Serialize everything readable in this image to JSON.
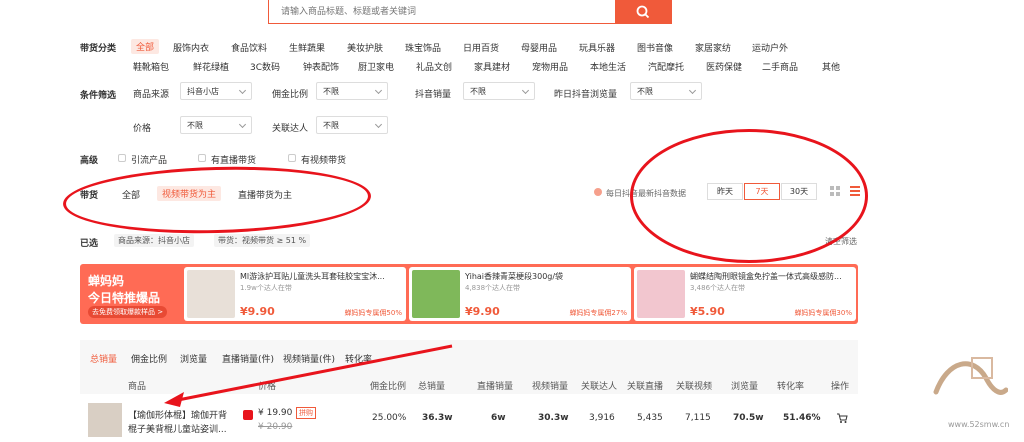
{
  "search": {
    "placeholder": "请输入商品标题、标题或者关键词"
  },
  "category": {
    "label": "带货分类",
    "row1": [
      "全部",
      "服饰内衣",
      "食品饮料",
      "生鲜蔬果",
      "美妆护肤",
      "珠宝饰品",
      "日用百货",
      "母婴用品",
      "玩具乐器",
      "图书音像",
      "家居家纺",
      "运动户外"
    ],
    "row2": [
      "鞋靴箱包",
      "鲜花绿植",
      "3C数码",
      "钟表配饰",
      "厨卫家电",
      "礼品文创",
      "家具建材",
      "宠物用品",
      "本地生活",
      "汽配摩托",
      "医药保健",
      "二手商品",
      "其他"
    ]
  },
  "filters": {
    "label": "条件筛选",
    "source_label": "商品来源",
    "source_value": "抖音小店",
    "commission_label": "佣金比例",
    "commission_value": "不限",
    "sales_label": "抖音销量",
    "sales_value": "不限",
    "views_label": "昨日抖音浏览量",
    "views_value": "不限",
    "price_label": "价格",
    "price_value": "不限",
    "talent_label": "关联达人",
    "talent_value": "不限"
  },
  "advanced": {
    "label": "高级",
    "opts": [
      "引流产品",
      "有直播带货",
      "有视频带货"
    ]
  },
  "delivery": {
    "label": "带货",
    "opts": [
      "全部",
      "视频带货为主",
      "直播带货为主"
    ],
    "active_index": 1
  },
  "update_note": "每日抖音最新抖音数据",
  "days": [
    "昨天",
    "7天",
    "30天"
  ],
  "days_active": 1,
  "selected": {
    "label": "已选",
    "tags": [
      "商品来源：抖音小店",
      "带货：视频带货 ≥ 51 %"
    ],
    "clear": "清空筛选"
  },
  "promo": {
    "title1": "蝉妈妈",
    "title2": "今日特推爆品",
    "link": "去免费领取爆款样品 >",
    "items": [
      {
        "title": "Ml游泳护耳贴儿童洗头耳套硅胶宝宝沐...",
        "sub": "1.9w个达人在带",
        "price": "¥9.90",
        "note": "蝉妈妈专属佣50%"
      },
      {
        "title": "Yihai香辣青菜梗段300g/袋",
        "sub": "4,838个达人在带",
        "price": "¥9.90",
        "note": "蝉妈妈专属佣27%"
      },
      {
        "title": "蝴蝶结陶刑眼镜盒免拧盖一体式高级感防...",
        "sub": "3,486个达人在带",
        "price": "¥5.90",
        "note": "蝉妈妈专属佣30%"
      }
    ]
  },
  "sort": [
    "总销量",
    "佣金比例",
    "浏览量",
    "直播销量(件)",
    "视频销量(件)",
    "转化率"
  ],
  "table": {
    "headers": [
      "商品",
      "价格",
      "佣金比例",
      "总销量",
      "直播销量",
      "视频销量",
      "关联达人",
      "关联直播",
      "关联视频",
      "浏览量",
      "转化率",
      "操作"
    ],
    "row": {
      "title1": "【瑜伽形体棍】瑜伽开背",
      "title2": "棍子美背棍儿童站姿训...",
      "price": "¥ 19.90",
      "badge": "拼购",
      "orig_price": "¥ 20.90",
      "commission": "25.00%",
      "total": "36.3w",
      "live": "6w",
      "video": "30.3w",
      "talent": "3,916",
      "live_rel": "5,435",
      "video_rel": "7,115",
      "views": "70.5w",
      "conv": "51.46%"
    }
  },
  "watermark": "www.52smw.cn",
  "colors": {
    "accent": "#f05a3a",
    "annotation": "#e8141c",
    "promo_bg": "#ff6b55"
  }
}
